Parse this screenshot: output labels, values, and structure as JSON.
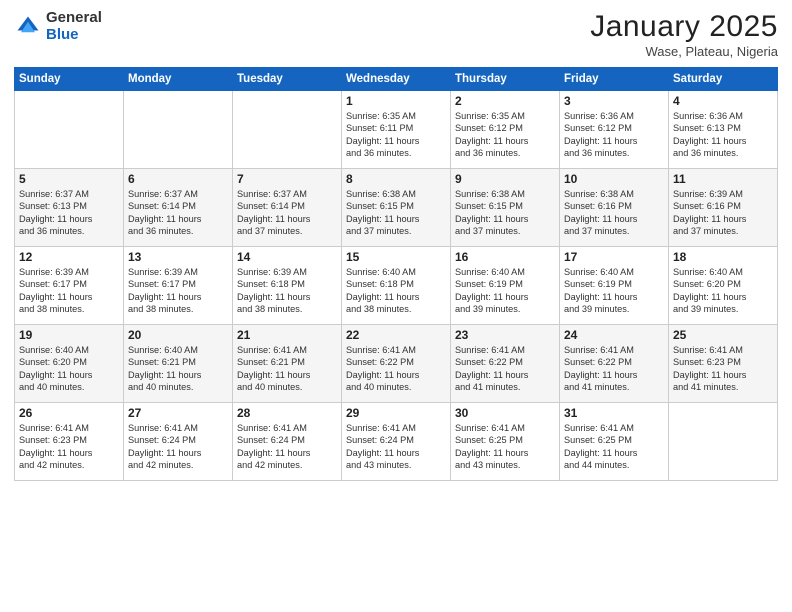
{
  "header": {
    "logo_general": "General",
    "logo_blue": "Blue",
    "month_title": "January 2025",
    "location": "Wase, Plateau, Nigeria"
  },
  "weekdays": [
    "Sunday",
    "Monday",
    "Tuesday",
    "Wednesday",
    "Thursday",
    "Friday",
    "Saturday"
  ],
  "weeks": [
    [
      {
        "day": "",
        "info": ""
      },
      {
        "day": "",
        "info": ""
      },
      {
        "day": "",
        "info": ""
      },
      {
        "day": "1",
        "info": "Sunrise: 6:35 AM\nSunset: 6:11 PM\nDaylight: 11 hours\nand 36 minutes."
      },
      {
        "day": "2",
        "info": "Sunrise: 6:35 AM\nSunset: 6:12 PM\nDaylight: 11 hours\nand 36 minutes."
      },
      {
        "day": "3",
        "info": "Sunrise: 6:36 AM\nSunset: 6:12 PM\nDaylight: 11 hours\nand 36 minutes."
      },
      {
        "day": "4",
        "info": "Sunrise: 6:36 AM\nSunset: 6:13 PM\nDaylight: 11 hours\nand 36 minutes."
      }
    ],
    [
      {
        "day": "5",
        "info": "Sunrise: 6:37 AM\nSunset: 6:13 PM\nDaylight: 11 hours\nand 36 minutes."
      },
      {
        "day": "6",
        "info": "Sunrise: 6:37 AM\nSunset: 6:14 PM\nDaylight: 11 hours\nand 36 minutes."
      },
      {
        "day": "7",
        "info": "Sunrise: 6:37 AM\nSunset: 6:14 PM\nDaylight: 11 hours\nand 37 minutes."
      },
      {
        "day": "8",
        "info": "Sunrise: 6:38 AM\nSunset: 6:15 PM\nDaylight: 11 hours\nand 37 minutes."
      },
      {
        "day": "9",
        "info": "Sunrise: 6:38 AM\nSunset: 6:15 PM\nDaylight: 11 hours\nand 37 minutes."
      },
      {
        "day": "10",
        "info": "Sunrise: 6:38 AM\nSunset: 6:16 PM\nDaylight: 11 hours\nand 37 minutes."
      },
      {
        "day": "11",
        "info": "Sunrise: 6:39 AM\nSunset: 6:16 PM\nDaylight: 11 hours\nand 37 minutes."
      }
    ],
    [
      {
        "day": "12",
        "info": "Sunrise: 6:39 AM\nSunset: 6:17 PM\nDaylight: 11 hours\nand 38 minutes."
      },
      {
        "day": "13",
        "info": "Sunrise: 6:39 AM\nSunset: 6:17 PM\nDaylight: 11 hours\nand 38 minutes."
      },
      {
        "day": "14",
        "info": "Sunrise: 6:39 AM\nSunset: 6:18 PM\nDaylight: 11 hours\nand 38 minutes."
      },
      {
        "day": "15",
        "info": "Sunrise: 6:40 AM\nSunset: 6:18 PM\nDaylight: 11 hours\nand 38 minutes."
      },
      {
        "day": "16",
        "info": "Sunrise: 6:40 AM\nSunset: 6:19 PM\nDaylight: 11 hours\nand 39 minutes."
      },
      {
        "day": "17",
        "info": "Sunrise: 6:40 AM\nSunset: 6:19 PM\nDaylight: 11 hours\nand 39 minutes."
      },
      {
        "day": "18",
        "info": "Sunrise: 6:40 AM\nSunset: 6:20 PM\nDaylight: 11 hours\nand 39 minutes."
      }
    ],
    [
      {
        "day": "19",
        "info": "Sunrise: 6:40 AM\nSunset: 6:20 PM\nDaylight: 11 hours\nand 40 minutes."
      },
      {
        "day": "20",
        "info": "Sunrise: 6:40 AM\nSunset: 6:21 PM\nDaylight: 11 hours\nand 40 minutes."
      },
      {
        "day": "21",
        "info": "Sunrise: 6:41 AM\nSunset: 6:21 PM\nDaylight: 11 hours\nand 40 minutes."
      },
      {
        "day": "22",
        "info": "Sunrise: 6:41 AM\nSunset: 6:22 PM\nDaylight: 11 hours\nand 40 minutes."
      },
      {
        "day": "23",
        "info": "Sunrise: 6:41 AM\nSunset: 6:22 PM\nDaylight: 11 hours\nand 41 minutes."
      },
      {
        "day": "24",
        "info": "Sunrise: 6:41 AM\nSunset: 6:22 PM\nDaylight: 11 hours\nand 41 minutes."
      },
      {
        "day": "25",
        "info": "Sunrise: 6:41 AM\nSunset: 6:23 PM\nDaylight: 11 hours\nand 41 minutes."
      }
    ],
    [
      {
        "day": "26",
        "info": "Sunrise: 6:41 AM\nSunset: 6:23 PM\nDaylight: 11 hours\nand 42 minutes."
      },
      {
        "day": "27",
        "info": "Sunrise: 6:41 AM\nSunset: 6:24 PM\nDaylight: 11 hours\nand 42 minutes."
      },
      {
        "day": "28",
        "info": "Sunrise: 6:41 AM\nSunset: 6:24 PM\nDaylight: 11 hours\nand 42 minutes."
      },
      {
        "day": "29",
        "info": "Sunrise: 6:41 AM\nSunset: 6:24 PM\nDaylight: 11 hours\nand 43 minutes."
      },
      {
        "day": "30",
        "info": "Sunrise: 6:41 AM\nSunset: 6:25 PM\nDaylight: 11 hours\nand 43 minutes."
      },
      {
        "day": "31",
        "info": "Sunrise: 6:41 AM\nSunset: 6:25 PM\nDaylight: 11 hours\nand 44 minutes."
      },
      {
        "day": "",
        "info": ""
      }
    ]
  ]
}
